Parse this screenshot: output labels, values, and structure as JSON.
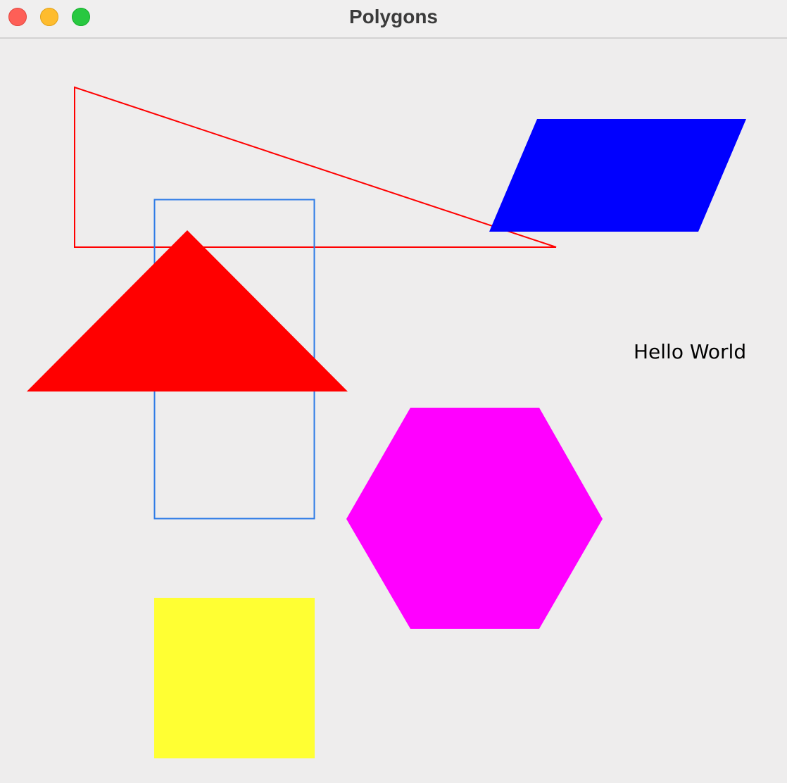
{
  "window": {
    "title": "Polygons",
    "controls": {
      "close_color": "#fe5f57",
      "minimize_color": "#febc2e",
      "zoom_color": "#28c840"
    }
  },
  "canvas": {
    "background": "#eeeded",
    "text": "Hello World",
    "text_color": "#000000",
    "shapes": {
      "outline_triangle": {
        "stroke": "#ff0000",
        "fill": "none"
      },
      "blue_parallelogram": {
        "fill": "#0000ff"
      },
      "blue_rectangle": {
        "stroke": "#2e7be6",
        "fill": "none"
      },
      "red_triangle": {
        "fill": "#ff0000"
      },
      "magenta_hexagon": {
        "fill": "#ff00ff"
      },
      "yellow_square": {
        "fill": "#ffff33"
      }
    }
  }
}
